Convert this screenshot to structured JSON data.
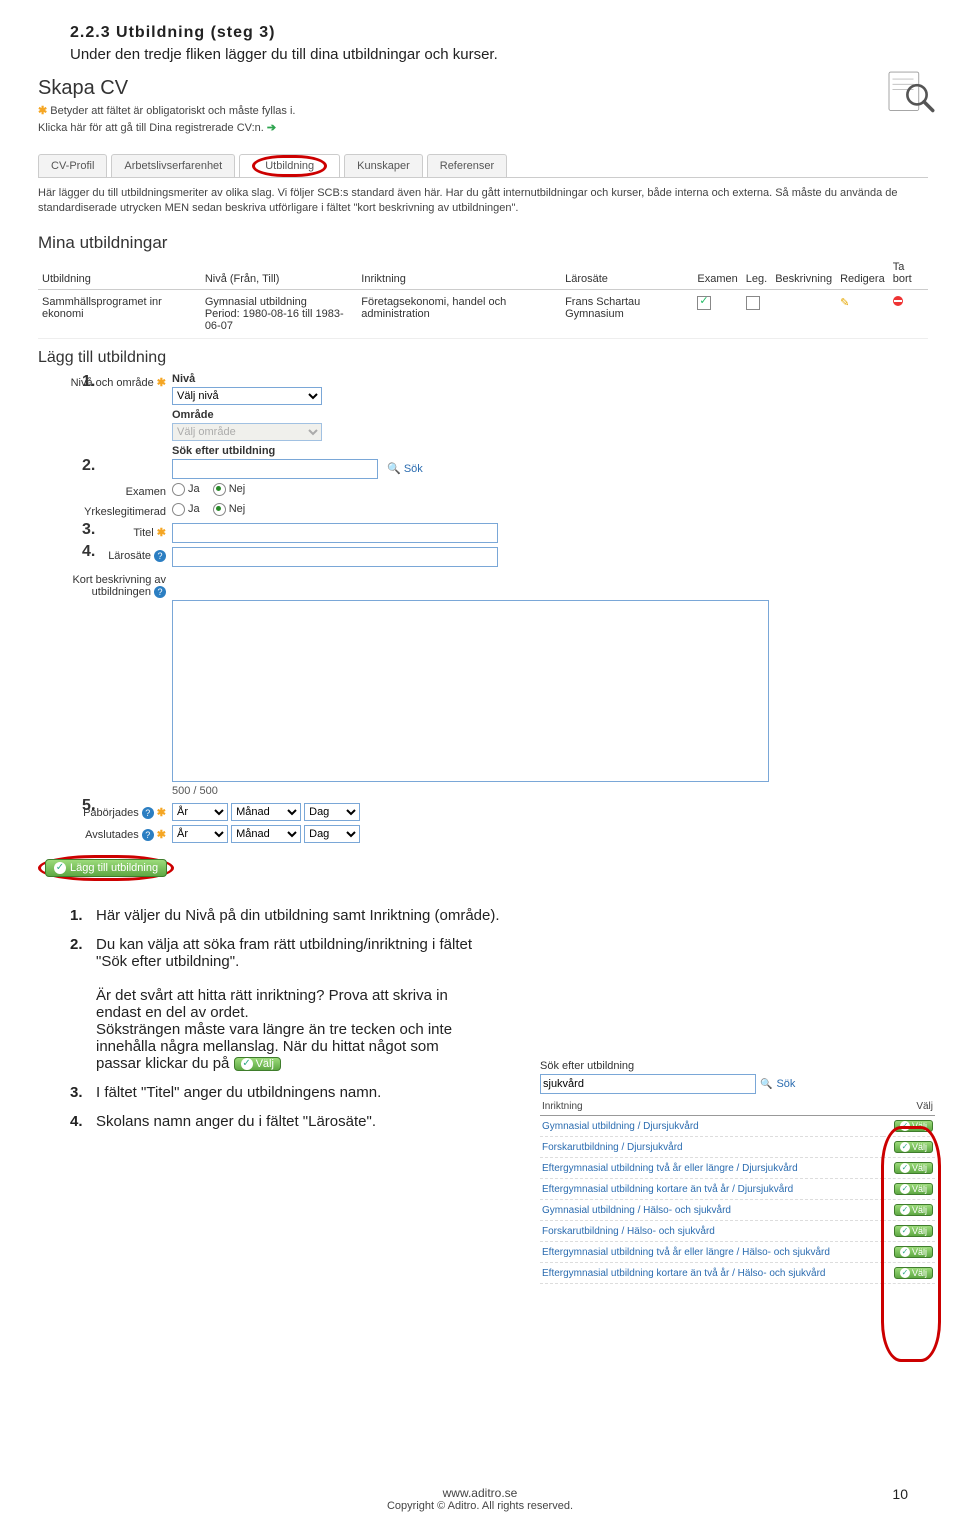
{
  "heading": {
    "num": "2.2.3",
    "title": "Utbildning (steg 3)",
    "sub": "Under den tredje fliken lägger du till dina utbildningar och kurser."
  },
  "skapa": {
    "title": "Skapa CV",
    "mandatory": "Betyder att fältet är obligatoriskt och måste fyllas i.",
    "reglink": "Klicka här för att gå till Dina registrerade CV:n."
  },
  "tabs": [
    "CV-Profil",
    "Arbetslivserfarenhet",
    "Utbildning",
    "Kunskaper",
    "Referenser"
  ],
  "tabs_active": 2,
  "tabdesc": "Här lägger du till utbildningsmeriter av olika slag. Vi följer SCB:s standard även här. Har du gått internutbildningar och kurser, både interna och externa. Så måste du använda de standardiserade utrycken MEN sedan beskriva utförligare i fältet \"kort beskrivning av utbildningen\".",
  "mina_title": "Mina utbildningar",
  "uth": {
    "c1": "Utbildning",
    "c2": "Nivå (Från, Till)",
    "c3": "Inriktning",
    "c4": "Lärosäte",
    "c5": "Examen",
    "c6": "Leg.",
    "c7": "Beskrivning",
    "c8": "Redigera",
    "c9": "Ta bort"
  },
  "utrow": {
    "c1": "Sammhällsprogramet inr ekonomi",
    "c2": "Gymnasial utbildning\nPeriod: 1980-08-16 till 1983-06-07",
    "c3": "Företagsekonomi, handel och administration",
    "c4": "Frans Schartau Gymnasium"
  },
  "lagg_title": "Lägg till utbildning",
  "form": {
    "niva_label": "Nivå och område",
    "niva_head": "Nivå",
    "niva_sel": "Välj nivå",
    "omr_head": "Område",
    "omr_sel": "Välj område",
    "sokut_head": "Sök efter utbildning",
    "sok_btn": "Sök",
    "examen_label": "Examen",
    "ja": "Ja",
    "nej": "Nej",
    "yrk_label": "Yrkeslegitimerad",
    "titel_label": "Titel",
    "laro_label": "Lärosäte",
    "kort_label": "Kort beskrivning av utbildningen",
    "counter": "500 / 500",
    "pab_label": "Påbörjades",
    "avs_label": "Avslutades",
    "ar": "År",
    "man": "Månad",
    "dag": "Dag",
    "addbtn": "Lägg till utbildning"
  },
  "numbers": {
    "n1": "1.",
    "n2": "2.",
    "n3": "3.",
    "n4": "4.",
    "n5": "5."
  },
  "instr": {
    "i1": "Här väljer du Nivå på din utbildning samt Inriktning (område).",
    "i2a": "Du kan välja att söka fram rätt utbildning/inriktning i fältet \"Sök efter utbildning\".",
    "i2b": "Är det svårt att hitta rätt inriktning? Prova att skriva in endast en del av ordet.",
    "i2c": "Söksträngen måste vara längre än tre tecken och inte innehålla några mellanslag. När du hittat något som passar klickar du på",
    "valj": "Välj",
    "i3": "I fältet \"Titel\" anger du utbildningens namn.",
    "i4": "Skolans namn anger du i fältet \"Lärosäte\"."
  },
  "side": {
    "title": "Sök efter utbildning",
    "value": "sjukvård",
    "sok": "Sök",
    "th": "Inriktning",
    "thv": "Välj",
    "rows": [
      "Gymnasial utbildning / Djursjukvård",
      "Forskarutbildning / Djursjukvård",
      "Eftergymnasial utbildning två år eller längre / Djursjukvård",
      "Eftergymnasial utbildning kortare än två år / Djursjukvård",
      "Gymnasial utbildning / Hälso- och sjukvård",
      "Forskarutbildning / Hälso- och sjukvård",
      "Eftergymnasial utbildning två år eller längre / Hälso- och sjukvård",
      "Eftergymnasial utbildning kortare än två år / Hälso- och sjukvård"
    ],
    "valj": "Välj"
  },
  "footer": {
    "l1": "www.aditro.se",
    "l2": "Copyright © Aditro. All rights reserved."
  },
  "pagenum": "10"
}
